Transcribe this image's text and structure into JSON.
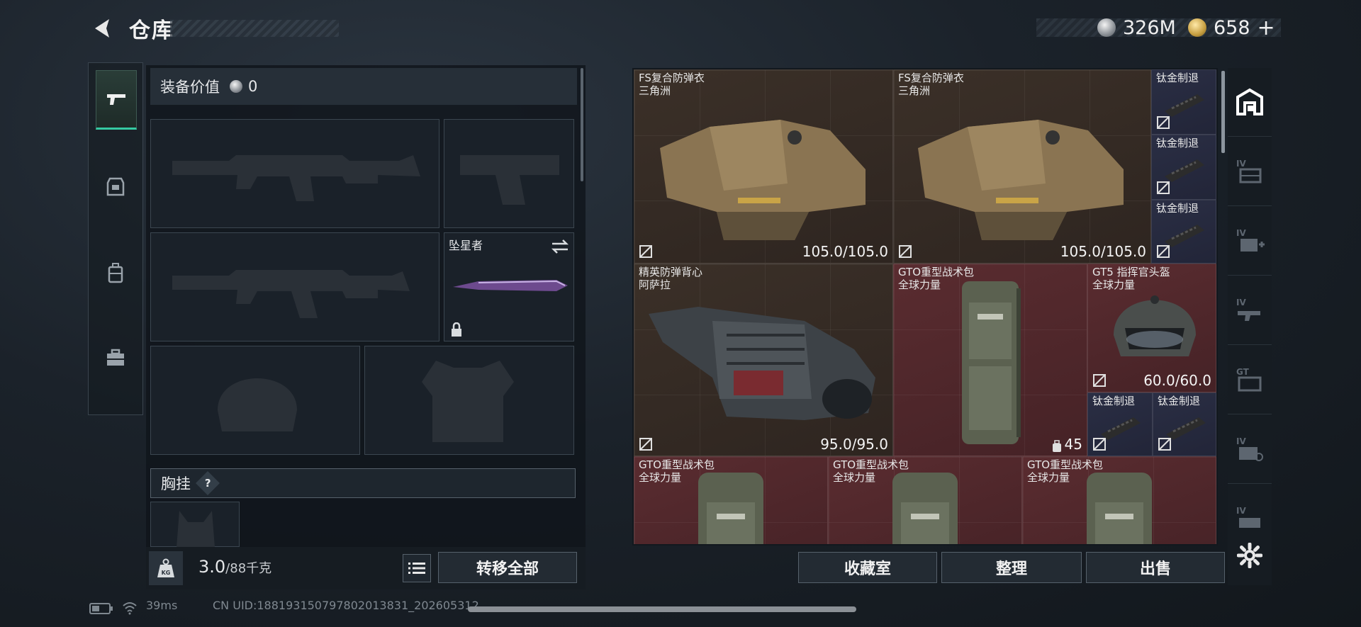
{
  "header": {
    "title": "仓库",
    "currency_silver": "326M",
    "currency_gold": "658",
    "gold_add": "+"
  },
  "equipment": {
    "value_label": "装备价值",
    "value": "0",
    "melee_name": "坠星者",
    "chest_label": "胸挂",
    "chest_help": "?",
    "weight_current": "3.0",
    "weight_max": "/88千克",
    "weight_icon": "KG",
    "transfer_all": "转移全部"
  },
  "storage": {
    "items": [
      {
        "name": "FS复合防弹衣",
        "sub": "三角洲",
        "durability": "105.0/105.0"
      },
      {
        "name": "FS复合防弹衣",
        "sub": "三角洲",
        "durability": "105.0/105.0"
      },
      {
        "name": "钛金制退",
        "sub": "",
        "durability": ""
      },
      {
        "name": "钛金制退",
        "sub": "",
        "durability": ""
      },
      {
        "name": "钛金制退",
        "sub": "",
        "durability": ""
      },
      {
        "name": "精英防弹背心",
        "sub": "阿萨拉",
        "durability": "95.0/95.0"
      },
      {
        "name": "GTO重型战术包",
        "sub": "全球力量",
        "durability": "",
        "capacity": "45"
      },
      {
        "name": "GT5 指挥官头盔",
        "sub": "全球力量",
        "durability": "60.0/60.0"
      },
      {
        "name": "钛金制退",
        "sub": "",
        "durability": ""
      },
      {
        "name": "钛金制退",
        "sub": "",
        "durability": ""
      },
      {
        "name": "GTO重型战术包",
        "sub": "全球力量",
        "durability": ""
      },
      {
        "name": "GTO重型战术包",
        "sub": "全球力量",
        "durability": ""
      },
      {
        "name": "GTO重型战术包",
        "sub": "全球力量",
        "durability": ""
      }
    ],
    "buttons": {
      "collection": "收藏室",
      "sort": "整理",
      "sell": "出售"
    }
  },
  "status_bar": {
    "ping": "39ms",
    "uid": "CN UID:18819315079780201383​1_202605312"
  },
  "colors": {
    "accent_green": "#35c9a2",
    "cell_brown": "#3b3028",
    "cell_red": "#5a2c30",
    "cell_blue": "#2a2e44"
  }
}
